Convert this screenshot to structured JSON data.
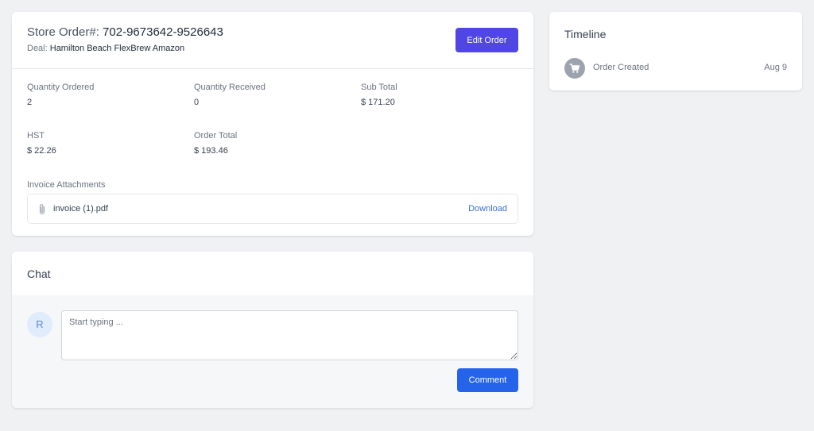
{
  "order": {
    "title_prefix": "Store Order#:",
    "order_number": "702-9673642-9526643",
    "deal_prefix": "Deal:",
    "deal_name": "Hamilton Beach FlexBrew Amazon",
    "edit_label": "Edit Order",
    "fields": [
      {
        "label": "Quantity Ordered",
        "value": "2"
      },
      {
        "label": "Quantity Received",
        "value": "0"
      },
      {
        "label": "Sub Total",
        "value": "$ 171.20"
      },
      {
        "label": "HST",
        "value": "$ 22.26"
      },
      {
        "label": "Order Total",
        "value": "$ 193.46"
      }
    ],
    "attachments_label": "Invoice Attachments",
    "attachment": {
      "file_name": "invoice (1).pdf",
      "download_label": "Download",
      "icon": "paperclip-icon"
    }
  },
  "chat": {
    "title": "Chat",
    "avatar_initial": "R",
    "input_placeholder": "Start typing ...",
    "comment_label": "Comment"
  },
  "timeline": {
    "title": "Timeline",
    "events": [
      {
        "label": "Order Created",
        "date": "Aug 9",
        "icon": "cart-icon"
      }
    ]
  },
  "colors": {
    "page_bg": "#f0f1f3",
    "edit_button": "#4f46e5",
    "comment_button": "#2563eb",
    "link": "#3b6fd9",
    "timeline_icon_bg": "#9ca3af"
  }
}
